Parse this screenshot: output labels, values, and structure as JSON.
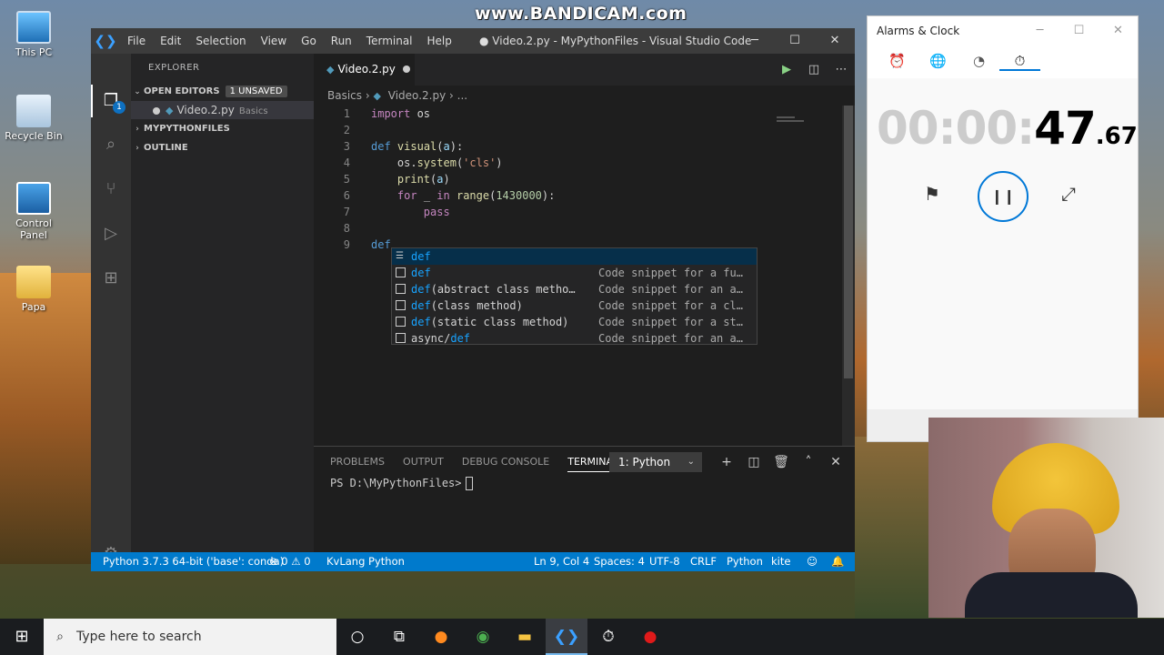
{
  "watermark": "www.BANDICAM.com",
  "desktop": {
    "icons": [
      {
        "label": "This PC"
      },
      {
        "label": "Recycle Bin"
      },
      {
        "label": "Control Panel"
      },
      {
        "label": "Papa"
      }
    ]
  },
  "vscode": {
    "menu": [
      "File",
      "Edit",
      "Selection",
      "View",
      "Go",
      "Run",
      "Terminal",
      "Help"
    ],
    "title": "● Video.2.py - MyPythonFiles - Visual Studio Code",
    "activity_badge": "1",
    "sidebar": {
      "title": "EXPLORER",
      "open_editors": "OPEN EDITORS",
      "unsaved": "1 UNSAVED",
      "file_name": "Video.2.py",
      "file_hint": "Basics",
      "folder": "MYPYTHONFILES",
      "outline": "OUTLINE"
    },
    "tab": {
      "label": "Video.2.py"
    },
    "breadcrumb": {
      "folder": "Basics",
      "file": "Video.2.py",
      "more": "..."
    },
    "line_numbers": [
      "1",
      "2",
      "3",
      "4",
      "5",
      "6",
      "7",
      "8",
      "9"
    ],
    "suggestions": [
      {
        "pre": "",
        "hl": "def",
        "post": "",
        "detail": ""
      },
      {
        "pre": "",
        "hl": "def",
        "post": "",
        "detail": "Code snippet for a fu…"
      },
      {
        "pre": "",
        "hl": "def",
        "post": "(abstract class metho…",
        "detail": "Code snippet for an a…"
      },
      {
        "pre": "",
        "hl": "def",
        "post": "(class method)",
        "detail": "Code snippet for a cl…"
      },
      {
        "pre": "",
        "hl": "def",
        "post": "(static class method)",
        "detail": "Code snippet for a st…"
      },
      {
        "pre": "async/",
        "hl": "def",
        "post": "",
        "detail": "Code snippet for an a…"
      }
    ],
    "panel": {
      "tabs": [
        "PROBLEMS",
        "OUTPUT",
        "DEBUG CONSOLE",
        "TERMINAL"
      ],
      "terminal_select": "1: Python",
      "prompt": "PS D:\\MyPythonFiles>"
    },
    "status": {
      "python": "Python 3.7.3 64-bit ('base': conda)",
      "errors": "⊗ 0 ⚠ 0",
      "kvlang": "KvLang Python",
      "position": "Ln 9, Col 4",
      "spaces": "Spaces: 4",
      "encoding": "UTF-8",
      "eol": "CRLF",
      "language": "Python",
      "kite": "kite"
    }
  },
  "alarms": {
    "title": "Alarms & Clock",
    "time_gray": "00:00:",
    "time_seconds": "47",
    "time_hundredths": ".67"
  },
  "taskbar": {
    "search_placeholder": "Type here to search"
  },
  "colors": {
    "accent": "#007acc",
    "highlight": "#18a3ff",
    "stopwatch_ring": "#0078d7"
  }
}
